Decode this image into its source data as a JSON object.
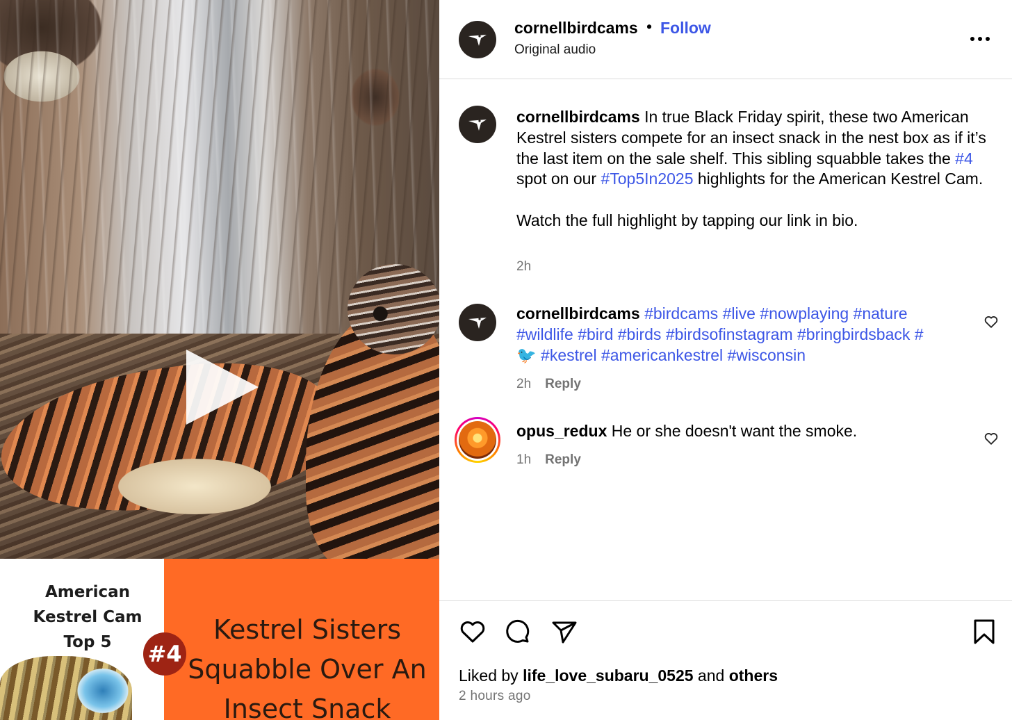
{
  "media": {
    "thumbnail_caption": [
      "American",
      "Kestrel Cam",
      "Top 5"
    ],
    "badge": "#4",
    "thumbnail_title": [
      "Kestrel Sisters",
      "Squabble Over An",
      "Insect Snack"
    ]
  },
  "header": {
    "username": "cornellbirdcams",
    "separator": "•",
    "follow_label": "Follow",
    "audio_label": "Original audio"
  },
  "caption": {
    "username": "cornellbirdcams",
    "text_1": " In true Black Friday spirit, these two American Kestrel sisters compete for an insect snack in the nest box as if it’s the last item on the sale shelf. This sibling squabble takes the ",
    "tag_1": "#4",
    "text_2": " spot on our ",
    "tag_2": "#Top5In2025",
    "text_3": " highlights for the American Kestrel Cam.",
    "text_4": "Watch the full highlight by tapping our link in bio.",
    "time": "2h"
  },
  "comments": [
    {
      "username": "cornellbirdcams",
      "tags_line1": [
        "#birdcams",
        "#live",
        "#nowplaying",
        "#nature"
      ],
      "tags_line2": [
        "#wildlife",
        "#bird",
        "#birds",
        "#birdsofinstagram",
        "#bringbirdsback",
        "#"
      ],
      "emoji": "🐦",
      "tags_line3": [
        "#kestrel",
        "#americankestrel",
        "#wisconsin"
      ],
      "time": "2h",
      "reply_label": "Reply"
    },
    {
      "username": "opus_redux",
      "text": " He or she doesn't want the smoke.",
      "time": "1h",
      "reply_label": "Reply"
    }
  ],
  "footer": {
    "liked_prefix": "Liked by ",
    "liked_user": "life_love_subaru_0525",
    "liked_mid": " and ",
    "liked_others": "others",
    "time_ago": "2 hours ago"
  },
  "colors": {
    "link_blue": "#3c56e6",
    "meta_gray": "#737373",
    "thumbnail_orange": "#ff6a25",
    "badge_red": "#9e2414"
  },
  "icons": {
    "play": "play-icon",
    "more": "more-icon",
    "like": "heart-icon",
    "comment": "comment-icon",
    "share": "share-icon",
    "save": "bookmark-icon"
  }
}
